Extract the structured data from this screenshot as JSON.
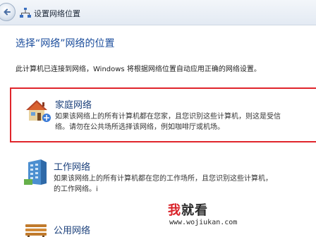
{
  "window": {
    "title": "设置网络位置"
  },
  "page": {
    "heading": "选择“网络”网络的位置",
    "intro": "此计算机已连接到网络，Windows 将根据网络位置自动应用正确的网络设置。"
  },
  "options": [
    {
      "title": "家庭网络",
      "desc_line1": "如果该网络上的所有计算机都在您家，且您识别这些计算机，则这是受信",
      "desc_line2": "络。请勿在公共场所选择该网络，例如咖啡厅或机场。",
      "icon": "home-network-icon",
      "selected": true
    },
    {
      "title": "工作网络",
      "desc_line1": "如果该网络上的所有计算机都在您的工作场所，且您识别这些计算机，",
      "desc_line2": "的工作网络。i",
      "icon": "work-network-icon",
      "selected": false
    },
    {
      "title": "公用网络",
      "icon": "public-network-icon",
      "selected": false
    }
  ],
  "watermark": {
    "char1": "我",
    "rest": "就看",
    "url": "www.wojiukan.com"
  },
  "colors": {
    "heading": "#1b4d9c",
    "selection_border": "#e0252b",
    "watermark_red": "#d9232a"
  }
}
